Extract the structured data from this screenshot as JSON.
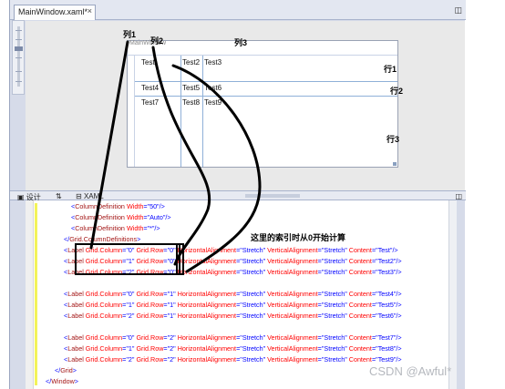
{
  "tab": {
    "title": "MainWindow.xaml*",
    "close": "×"
  },
  "window": {
    "title": "MainWindow"
  },
  "grid_cells": [
    "Test",
    "Test2",
    "Test3",
    "Test4",
    "Test5",
    "Test6",
    "Test7",
    "Test8",
    "Test9"
  ],
  "annotations": {
    "col1": "列1",
    "col2": "列2",
    "col3": "列3",
    "row1": "行1",
    "row2": "行2",
    "row3": "行3",
    "index_note": "这里的索引时从0开始计算"
  },
  "split_tabs": {
    "design": "设计",
    "swap": "⇅",
    "xaml": "XAML"
  },
  "code_lines": [
    "<ColumnDefinition Width=\"50\"/>",
    "<ColumnDefinition Width=\"Auto\"/>",
    "<ColumnDefinition Width=\"*\"/>",
    "</Grid.ColumnDefinitions>",
    "<Label Grid.Column=\"0\" Grid.Row=\"0\" HorizontalAlignment=\"Stretch\" VerticalAlignment=\"Stretch\" Content=\"Test\"/>",
    "<Label Grid.Column=\"1\" Grid.Row=\"0\" HorizontalAlignment=\"Stretch\" VerticalAlignment=\"Stretch\" Content=\"Test2\"/>",
    "<Label Grid.Column=\"2\" Grid.Row=\"0\" HorizontalAlignment=\"Stretch\" VerticalAlignment=\"Stretch\" Content=\"Test3\"/>",
    "",
    "<Label Grid.Column=\"0\" Grid.Row=\"1\" HorizontalAlignment=\"Stretch\" VerticalAlignment=\"Stretch\" Content=\"Test4\"/>",
    "<Label Grid.Column=\"1\" Grid.Row=\"1\" HorizontalAlignment=\"Stretch\" VerticalAlignment=\"Stretch\" Content=\"Test5\"/>",
    "<Label Grid.Column=\"2\" Grid.Row=\"1\" HorizontalAlignment=\"Stretch\" VerticalAlignment=\"Stretch\" Content=\"Test6\"/>",
    "",
    "<Label Grid.Column=\"0\" Grid.Row=\"2\" HorizontalAlignment=\"Stretch\" VerticalAlignment=\"Stretch\" Content=\"Test7\"/>",
    "<Label Grid.Column=\"1\" Grid.Row=\"2\" HorizontalAlignment=\"Stretch\" VerticalAlignment=\"Stretch\" Content=\"Test8\"/>",
    "<Label Grid.Column=\"2\" Grid.Row=\"2\" HorizontalAlignment=\"Stretch\" VerticalAlignment=\"Stretch\" Content=\"Test9\"/>",
    "</Grid>",
    "</Window>"
  ],
  "watermark": "CSDN @Awful*",
  "colors": {
    "xaml_bracket": "#0000ff",
    "xaml_tag": "#a31515",
    "xaml_attribute": "#ff0000",
    "xaml_value": "#0000ff",
    "grid_guide": "#8fb0d8",
    "annotation_ink": "#000000"
  }
}
